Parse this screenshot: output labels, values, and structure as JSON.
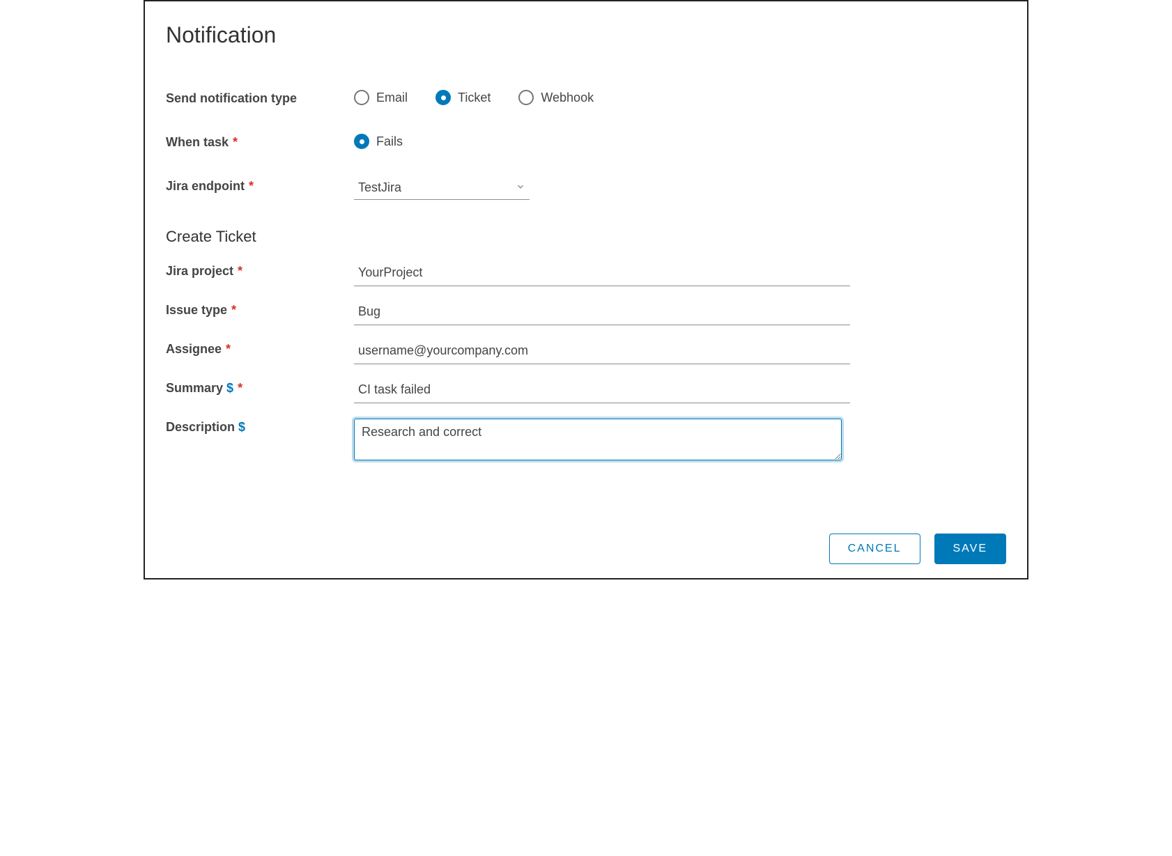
{
  "title": "Notification",
  "labels": {
    "type": "Send notification type",
    "whenTask": "When task",
    "jiraEndpoint": "Jira endpoint",
    "createTicket": "Create Ticket",
    "jiraProject": "Jira project",
    "issueType": "Issue type",
    "assignee": "Assignee",
    "summary": "Summary",
    "description": "Description"
  },
  "typeOptions": {
    "email": "Email",
    "ticket": "Ticket",
    "webhook": "Webhook"
  },
  "whenTaskOptions": {
    "fails": "Fails"
  },
  "values": {
    "jiraEndpoint": "TestJira",
    "jiraProject": "YourProject",
    "issueType": "Bug",
    "assignee": "username@yourcompany.com",
    "summary": "CI task failed",
    "description": "Research and correct"
  },
  "buttons": {
    "cancel": "CANCEL",
    "save": "SAVE"
  },
  "glyphs": {
    "required": "*",
    "dollar": "$"
  }
}
